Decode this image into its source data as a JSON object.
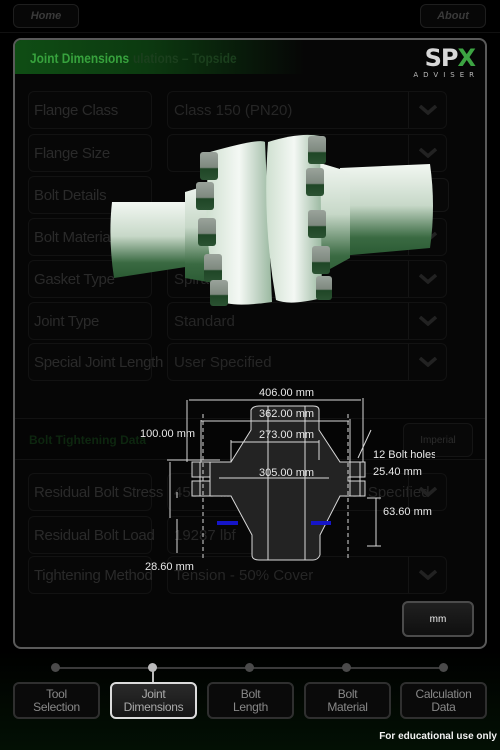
{
  "topbar": {
    "home_label": "Home",
    "about_label": "About"
  },
  "panel": {
    "title": "Joint Dimensions",
    "title_ghost": "ulations – Topside",
    "logo": {
      "main_left": "SP",
      "main_right": "X",
      "sub": "ADVISER"
    },
    "rows": [
      {
        "label": "Flange Class",
        "value": "Class 150 (PN20)",
        "has_dropdown": true
      },
      {
        "label": "Flange Size",
        "value": "",
        "has_dropdown": true
      },
      {
        "label": "Bolt Details",
        "value": "",
        "button": "Imperial"
      },
      {
        "label": "Bolt Material",
        "value": "",
        "has_dropdown": true
      },
      {
        "label": "Gasket Type",
        "value": "Spiral Wound",
        "has_dropdown": true
      },
      {
        "label": "Joint Type",
        "value": "Standard",
        "has_dropdown": true
      },
      {
        "label": "Special Joint Length",
        "value": "User Specified",
        "has_dropdown": true
      }
    ],
    "section2": {
      "title": "Bolt Tightening Data",
      "button": "Imperial"
    },
    "rows2": [
      {
        "label": "Residual Bolt Stress",
        "value": "45000 lbf / in.²",
        "value2": "User Specified",
        "has_dropdown": true
      },
      {
        "label": "Residual Bolt Load",
        "value": "19287 lbf"
      },
      {
        "label": "Tightening Method",
        "value": "Tension - 50%  Cover",
        "has_dropdown": true
      }
    ],
    "unit_button": "mm"
  },
  "drawing": {
    "dims": {
      "outer_diameter": "406.00 mm",
      "bolt_circle": "362.00 mm",
      "hub_diameter": "273.00 mm",
      "bore": "305.00 mm",
      "hub_length": "100.00 mm",
      "flange_thickness": "28.60 mm",
      "joint_gap": "63.60 mm",
      "bolt_holes_line1": "12 Bolt holes",
      "bolt_holes_line2": "25.40 mm"
    },
    "colors": {
      "gasket": "#1515c8",
      "line": "#d8d8d8",
      "body": "#2a2a2a"
    }
  },
  "steps": {
    "items": [
      {
        "label": "Tool\nSelection",
        "active": false
      },
      {
        "label": "Joint\nDimensions",
        "active": true
      },
      {
        "label": "Bolt\nLength",
        "active": false
      },
      {
        "label": "Bolt\nMaterial",
        "active": false
      },
      {
        "label": "Calculation\nData",
        "active": false
      }
    ]
  },
  "footer": {
    "note": "For educational use only"
  },
  "colors": {
    "accent_green": "#37a23d",
    "logo_green": "#3da443"
  }
}
